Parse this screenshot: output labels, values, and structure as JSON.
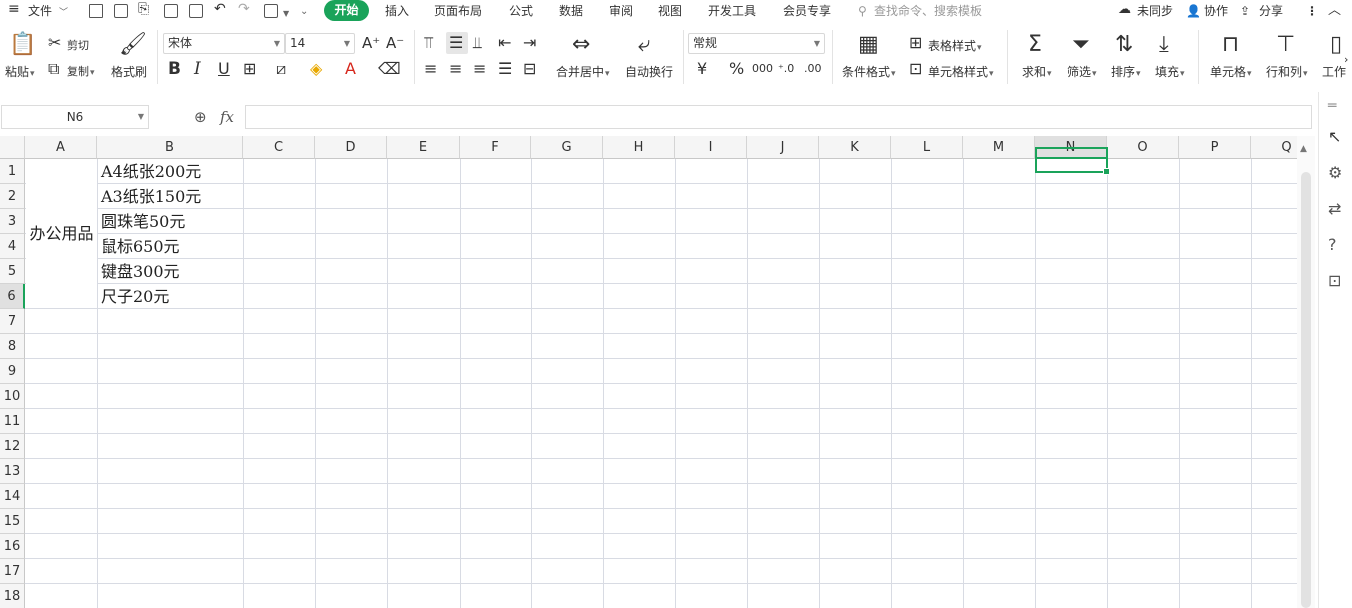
{
  "titlebar": {
    "file_menu": "文件",
    "tabs": [
      "开始",
      "插入",
      "页面布局",
      "公式",
      "数据",
      "审阅",
      "视图",
      "开发工具",
      "会员专享"
    ],
    "search_placeholder": "查找命令、搜索模板",
    "sync": "未同步",
    "collab": "协作",
    "share": "分享"
  },
  "ribbon": {
    "paste": "粘贴",
    "cut": "剪切",
    "copy": "复制",
    "format_painter": "格式刷",
    "font_name": "宋体",
    "font_size": "14",
    "merge_center": "合并居中",
    "wrap_text": "自动换行",
    "number_format": "常规",
    "conditional_format": "条件格式",
    "table_style": "表格样式",
    "cell_style": "单元格样式",
    "sum": "求和",
    "filter": "筛选",
    "sort": "排序",
    "fill": "填充",
    "cell": "单元格",
    "row_col": "行和列",
    "worksheet": "工作"
  },
  "formula_bar": {
    "name_box": "N6",
    "fx": "fx",
    "value": ""
  },
  "sheet": {
    "columns": [
      "A",
      "B",
      "C",
      "D",
      "E",
      "F",
      "G",
      "H",
      "I",
      "J",
      "K",
      "L",
      "M",
      "N",
      "O",
      "P",
      "Q"
    ],
    "rows": [
      "1",
      "2",
      "3",
      "4",
      "5",
      "6",
      "7",
      "8",
      "9",
      "10",
      "11",
      "12",
      "13",
      "14",
      "15",
      "16",
      "17",
      "18"
    ],
    "merged_a1_a6": "办公用品",
    "b_cells": [
      "A4纸张200元",
      "A3纸张150元",
      "圆珠笔50元",
      "鼠标650元",
      "键盘300元",
      "尺子20元"
    ],
    "active_cell": "N6"
  },
  "colors": {
    "accent": "#1aa35a",
    "header_bg": "#f5f5f5",
    "gridline": "#d8dbe3"
  }
}
